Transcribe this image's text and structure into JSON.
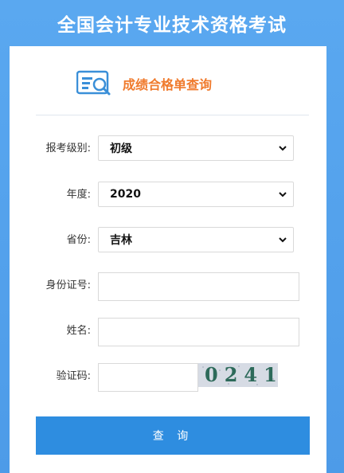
{
  "header": {
    "title": "全国会计专业技术资格考试"
  },
  "panel": {
    "title": "成绩合格单查询",
    "icon": "document-search-icon"
  },
  "form": {
    "level": {
      "label": "报考级别:",
      "value": "初级"
    },
    "year": {
      "label": "年度:",
      "value": "2020"
    },
    "province": {
      "label": "省份:",
      "value": "吉林"
    },
    "id_number": {
      "label": "身份证号:",
      "value": ""
    },
    "name": {
      "label": "姓名:",
      "value": ""
    },
    "captcha": {
      "label": "验证码:",
      "value": "",
      "image_text": "0241"
    }
  },
  "submit_label": "查 询",
  "colors": {
    "accent": "#2e8de0",
    "title_orange": "#f07a2c",
    "header_blue": "#5aa8f0"
  }
}
